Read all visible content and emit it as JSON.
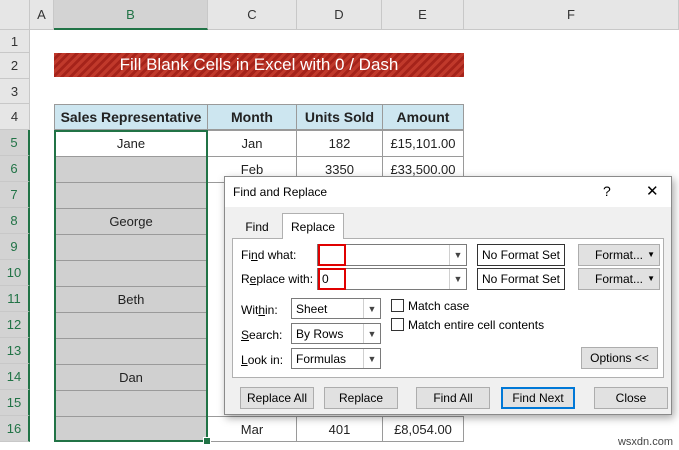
{
  "sheet": {
    "columns": [
      "A",
      "B",
      "C",
      "D",
      "E",
      "F"
    ],
    "rows": [
      "1",
      "2",
      "3",
      "4",
      "5",
      "6",
      "7",
      "8",
      "9",
      "10",
      "11",
      "12",
      "13",
      "14",
      "15",
      "16"
    ],
    "title": "Fill Blank Cells in Excel with 0 / Dash",
    "headers": [
      "Sales Representative",
      "Month",
      "Units Sold",
      "Amount"
    ],
    "visible_cells": {
      "b5": "Jane",
      "c5": "Jan",
      "d5": "182",
      "e5": "£15,101.00",
      "c6": "Feb",
      "d6": "3350",
      "e6": "£33,500.00",
      "b8": "George",
      "b11": "Beth",
      "b14": "Dan",
      "c16": "Mar",
      "d16": "401",
      "e16": "£8,054.00"
    }
  },
  "dialog": {
    "title": "Find and Replace",
    "help": "?",
    "close": "✕",
    "tabs": {
      "find": "Find",
      "replace": "Replace"
    },
    "find_what": {
      "label_pre": "Fi",
      "label_u": "n",
      "label_post": "d what:",
      "value": ""
    },
    "replace_with": {
      "label_pre": "R",
      "label_u": "e",
      "label_post": "place with:",
      "value": "0"
    },
    "no_format_set": "No Format Set",
    "format_btn": "Format...",
    "within": {
      "label_pre": "Wit",
      "label_u": "h",
      "label_post": "in:",
      "value": "Sheet"
    },
    "search": {
      "label_pre": "",
      "label_u": "S",
      "label_post": "earch:",
      "value": "By Rows"
    },
    "look_in": {
      "label_pre": "",
      "label_u": "L",
      "label_post": "ook in:",
      "value": "Formulas"
    },
    "match_case": "Match case",
    "match_entire": "Match entire cell contents",
    "options": "Options <<",
    "buttons": {
      "replace_all": "Replace All",
      "replace": "Replace",
      "find_all": "Find All",
      "find_next": "Find Next",
      "close": "Close"
    }
  },
  "watermark": "wsxdn.com"
}
